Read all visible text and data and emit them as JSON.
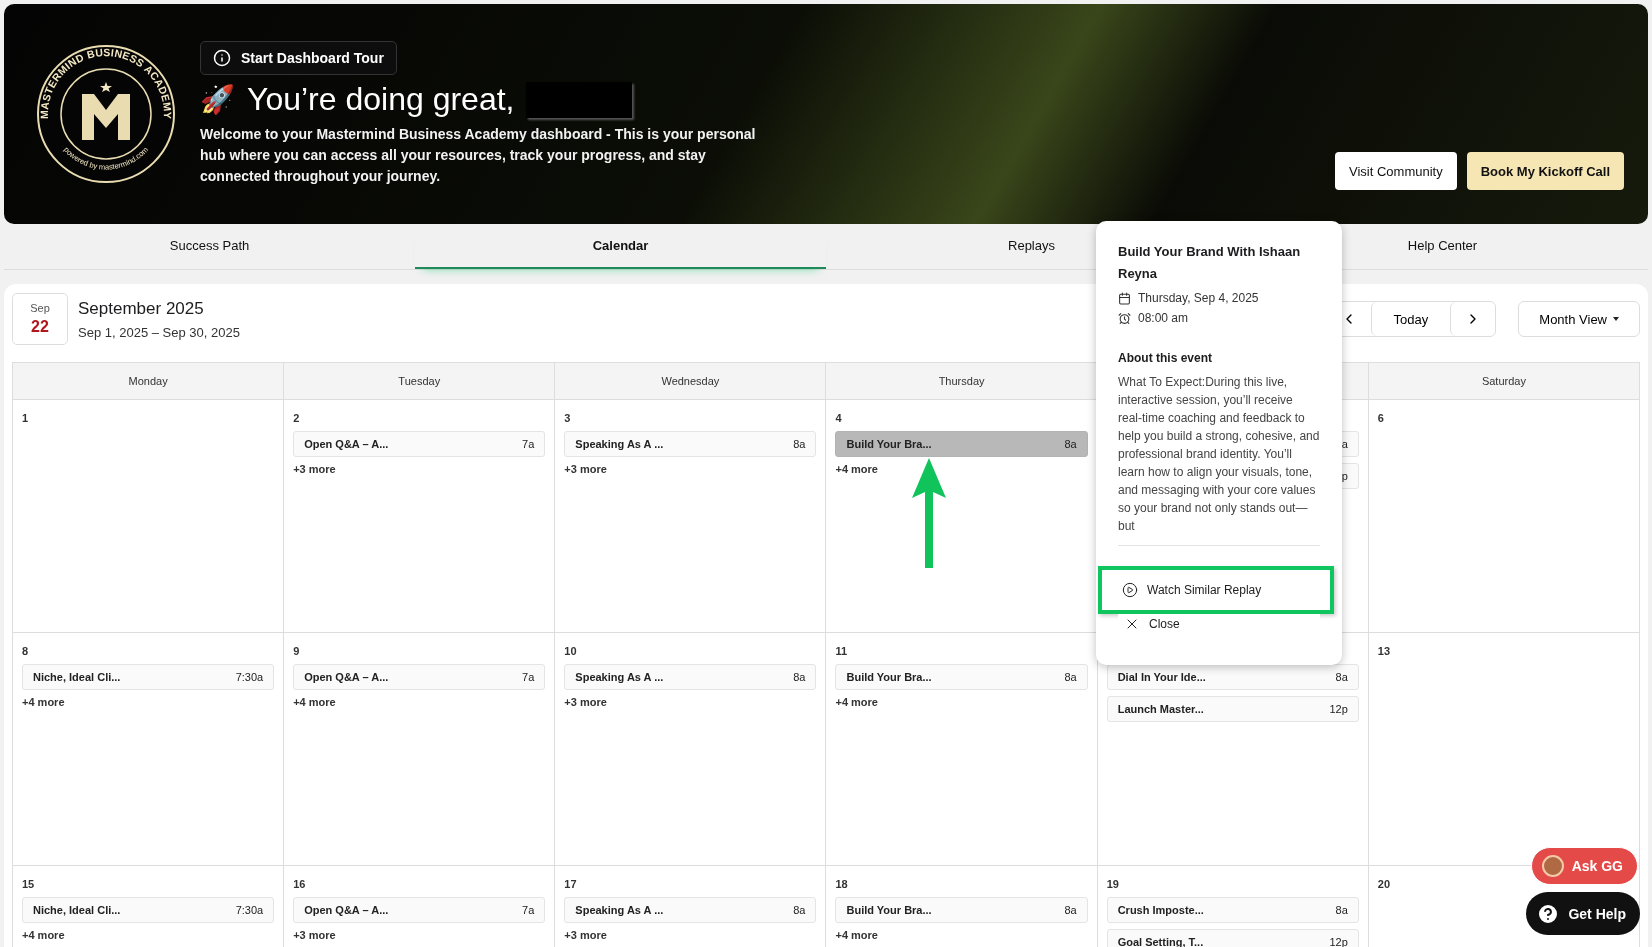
{
  "banner": {
    "logo_top": "MASTERMIND BUSINESS ACADEMY",
    "logo_bottom": "powered by mastermind.com",
    "tour_button": "Start Dashboard Tour",
    "heading": "You’re doing great,",
    "heading_icon": "🚀",
    "welcome": "Welcome to your Mastermind Business Academy dashboard - This is your personal hub where you can access all your resources, track your progress, and stay connected throughout your journey.",
    "buttons": [
      {
        "label": "Visit Community",
        "kind": "outline"
      },
      {
        "label": "Book My Kickoff Call",
        "kind": "primary"
      }
    ]
  },
  "tabs": [
    {
      "label": "Success Path",
      "selected": false
    },
    {
      "label": "Calendar",
      "selected": true
    },
    {
      "label": "Replays",
      "selected": false
    },
    {
      "label": "Help Center",
      "selected": false
    }
  ],
  "calendar": {
    "badge_month": "Sep",
    "badge_day": "22",
    "title": "September 2025",
    "range": "Sep 1, 2025 – Sep 30, 2025",
    "today": "Today",
    "view": "Month View",
    "columns": [
      {
        "label": "Monday"
      },
      {
        "label": "Tuesday"
      },
      {
        "label": "Wednesday"
      },
      {
        "label": "Thursday"
      },
      {},
      {
        "label": "Saturday"
      }
    ],
    "weeks": [
      [
        {
          "day": "1"
        },
        {
          "day": "2",
          "events": [
            {
              "title": "Open Q&A – A...",
              "time": "7a",
              "selected": false
            }
          ],
          "more": "+3 more"
        },
        {
          "day": "3",
          "events": [
            {
              "title": "Speaking As A ...",
              "time": "8a",
              "selected": false
            }
          ],
          "more": "+3 more"
        },
        {
          "day": "4",
          "events": [
            {
              "title": "Build Your Bra...",
              "time": "8a",
              "selected": true
            }
          ],
          "more": "+4 more"
        },
        {
          "events": [
            {
              "time": "a",
              "selected": false
            },
            {
              "time": "p",
              "selected": false
            }
          ]
        },
        {
          "day": "6"
        }
      ],
      [
        {
          "day": "8",
          "events": [
            {
              "title": "Niche, Ideal Cli...",
              "time": "7:30a",
              "selected": false
            }
          ],
          "more": "+4 more"
        },
        {
          "day": "9",
          "events": [
            {
              "title": "Open Q&A – A...",
              "time": "7a",
              "selected": false
            }
          ],
          "more": "+4 more"
        },
        {
          "day": "10",
          "events": [
            {
              "title": "Speaking As A ...",
              "time": "8a",
              "selected": false
            }
          ],
          "more": "+3 more"
        },
        {
          "day": "11",
          "events": [
            {
              "title": "Build Your Bra...",
              "time": "8a",
              "selected": false
            }
          ],
          "more": "+4 more"
        },
        {
          "events": [
            {
              "title": "Dial In Your Ide...",
              "time": "8a",
              "selected": false
            },
            {
              "title": "Launch Master...",
              "time": "12p",
              "selected": false
            }
          ]
        },
        {
          "day": "13"
        }
      ],
      [
        {
          "day": "15",
          "events": [
            {
              "title": "Niche, Ideal Cli...",
              "time": "7:30a",
              "selected": false
            }
          ],
          "more": "+4 more"
        },
        {
          "day": "16",
          "events": [
            {
              "title": "Open Q&A – A...",
              "time": "7a",
              "selected": false
            }
          ],
          "more": "+3 more"
        },
        {
          "day": "17",
          "events": [
            {
              "title": "Speaking As A ...",
              "time": "8a",
              "selected": false
            }
          ],
          "more": "+3 more"
        },
        {
          "day": "18",
          "events": [
            {
              "title": "Build Your Bra...",
              "time": "8a",
              "selected": false
            }
          ],
          "more": "+4 more"
        },
        {
          "day": "19",
          "events": [
            {
              "title": "Crush Imposte...",
              "time": "8a",
              "selected": false
            },
            {
              "title": "Goal Setting, T...",
              "time": "12p",
              "selected": false
            }
          ]
        },
        {
          "day": "20"
        }
      ]
    ]
  },
  "popover": {
    "title": "Build Your Brand With Ishaan Reyna",
    "date": "Thursday, Sep 4, 2025",
    "time": "08:00 am",
    "about_heading": "About this event",
    "description": "What To Expect:During this live, interactive session, you’ll receive real-time coaching and feedback to help you build a strong, cohesive, and professional brand identity. You’ll learn how to align your visuals, tone, and messaging with your core values so your brand not only stands out—but",
    "actions": [
      {
        "label": "Watch Similar Replay",
        "kind": "play",
        "highlighted": true
      },
      {
        "label": "Close",
        "kind": "close",
        "highlighted": false
      }
    ]
  },
  "floating": [
    {
      "label": "Ask GG",
      "kind": "avatar"
    },
    {
      "label": "Get Help",
      "kind": "help"
    }
  ]
}
